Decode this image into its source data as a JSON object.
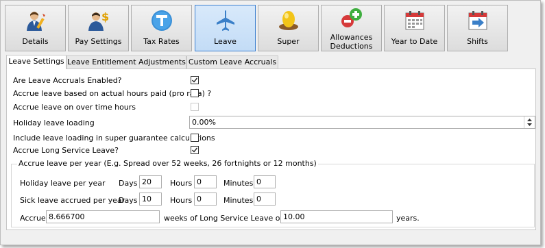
{
  "toolbar": {
    "buttons": [
      {
        "label": "Details",
        "icon": "person-edit-icon"
      },
      {
        "label": "Pay Settings",
        "icon": "person-dollar-icon"
      },
      {
        "label": "Tax Rates",
        "icon": "tax-t-icon"
      },
      {
        "label": "Leave",
        "icon": "airplane-icon",
        "active": true
      },
      {
        "label": "Super",
        "icon": "nest-egg-icon"
      },
      {
        "label": "Allowances Deductions",
        "label_line1": "Allowances",
        "label_line2": "Deductions",
        "icon": "plus-minus-icon"
      },
      {
        "label": "Year to Date",
        "icon": "calendar-icon"
      },
      {
        "label": "Shifts",
        "icon": "calendar-arrow-icon"
      }
    ]
  },
  "tabs": [
    {
      "label": "Leave Settings",
      "active": true
    },
    {
      "label": "Leave Entitlement Adjustments"
    },
    {
      "label": "Custom Leave Accruals"
    }
  ],
  "settings": {
    "accruals_enabled": {
      "label": "Are Leave Accruals Enabled?",
      "checked": true
    },
    "pro_rata": {
      "label": "Accrue leave based on actual hours paid (pro rata) ?",
      "checked": false
    },
    "overtime": {
      "label": "Accrue leave on over time hours",
      "checked": false,
      "disabled": true
    },
    "holiday_loading": {
      "label": "Holiday leave loading",
      "value": "0.00%"
    },
    "super_guarantee": {
      "label": "Include leave loading in super guarantee calculations",
      "checked": false
    },
    "long_service": {
      "label": "Accrue Long Service Leave?",
      "checked": true
    }
  },
  "accrual_group": {
    "title": "Accrue leave per year (E.g. Spread over 52 weeks, 26 fortnights or 12 months)",
    "holiday": {
      "label": "Holiday leave per year",
      "days_label": "Days",
      "days": "20",
      "hours_label": "Hours",
      "hours": "0",
      "minutes_label": "Minutes",
      "minutes": "0"
    },
    "sick": {
      "label": "Sick leave accrued per year",
      "days_label": "Days",
      "days": "10",
      "hours_label": "Hours",
      "hours": "0",
      "minutes_label": "Minutes",
      "minutes": "0"
    },
    "lsl": {
      "accrue_label": "Accrue",
      "weeks": "8.666700",
      "mid_label": "weeks of Long Service Leave over",
      "years": "10.00",
      "years_label": "years."
    }
  },
  "colors": {
    "accent": "#3b7fcf",
    "active_bg": "#c3dcf6"
  }
}
